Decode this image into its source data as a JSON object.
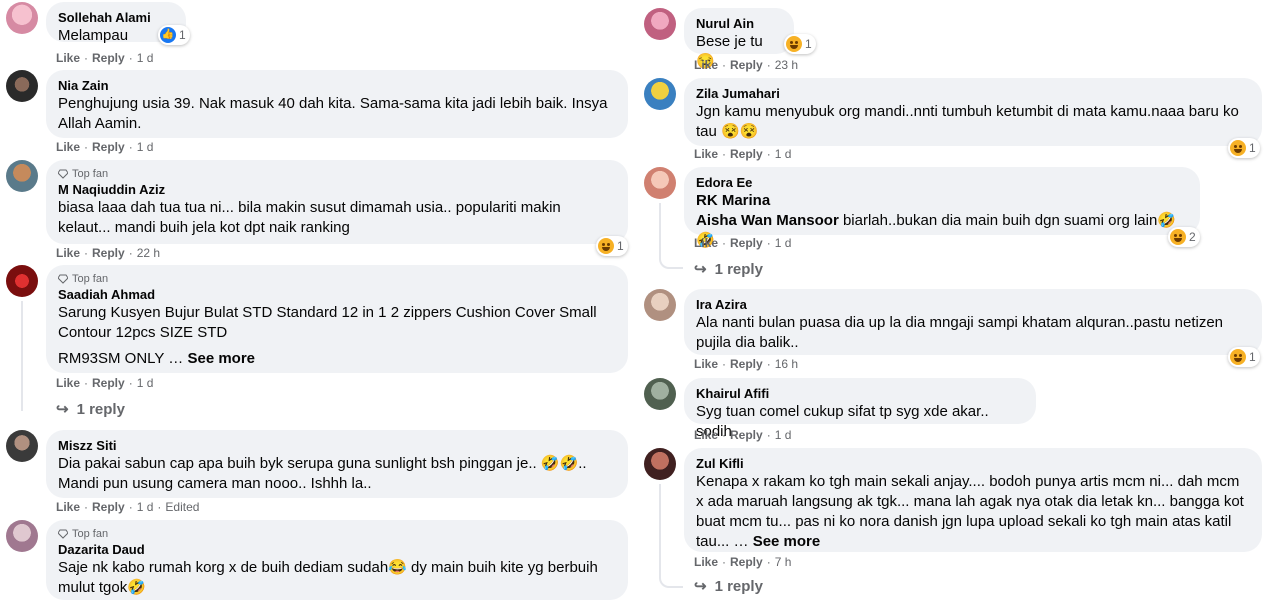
{
  "labels": {
    "like": "Like",
    "reply": "Reply",
    "top_fan": "Top fan",
    "see_more": "See more",
    "edited": "Edited"
  },
  "left_comments": [
    {
      "author": "Sollehah Alami",
      "text": "Melampau",
      "time": "1 d",
      "reaction": {
        "icon": "like-reaction-icon",
        "count": "1"
      }
    },
    {
      "author": "Nia Zain",
      "text": "Penghujung usia 39. Nak masuk 40 dah kita. Sama-sama kita jadi lebih baik. Insya Allah Aamin.",
      "time": "1 d"
    },
    {
      "author": "M Naqiuddin Aziz",
      "top_fan": true,
      "text": "biasa laaa dah tua tua ni... bila makin susut dimamah usia.. populariti makin kelaut... mandi buih jela kot dpt naik ranking",
      "time": "22 h",
      "reaction": {
        "icon": "haha-reaction-icon",
        "count": "1"
      }
    },
    {
      "author": "Saadiah Ahmad",
      "top_fan": true,
      "text": "Sarung Kusyen Bujur Bulat STD Standard 12 in 1 2 zippers Cushion Cover Small Contour 12pcs SIZE STD",
      "text2": "RM93SM ONLY …",
      "time": "1 d",
      "replies": "1 reply"
    },
    {
      "author": "Miszz Siti",
      "text": "Dia pakai sabun cap apa buih byk serupa guna sunlight bsh pinggan je.. 🤣🤣.. Mandi pun usung camera man nooo.. Ishhh la..",
      "time": "1 d",
      "edited": true
    },
    {
      "author": "Dazarita Daud",
      "top_fan": true,
      "text": "Saje nk kabo rumah korg x de buih dediam sudah😂 dy main buih kite yg berbuih mulut tgok🤣"
    }
  ],
  "right_comments": [
    {
      "author": "Nurul Ain",
      "text": "Bese je tu 😒",
      "time": "23 h",
      "reaction": {
        "icon": "haha-reaction-icon",
        "count": "1"
      }
    },
    {
      "author": "Zila Jumahari",
      "text": "Jgn kamu menyubuk org mandi..nnti tumbuh ketumbit di mata kamu.naaa baru ko tau 😵😵",
      "time": "1 d",
      "reaction": {
        "icon": "haha-reaction-icon",
        "count": "1"
      }
    },
    {
      "author": "Edora Ee",
      "text_line1": "RK Marina",
      "mention": "Aisha Wan Mansoor",
      "text": " biarlah..bukan dia main buih dgn suami org lain🤣🤣",
      "time": "1 d",
      "reaction": {
        "icon": "haha-reaction-icon",
        "count": "2"
      },
      "replies": "1 reply"
    },
    {
      "author": "Ira Azira",
      "text": "Ala nanti bulan puasa dia up la dia mngaji sampi khatam alquran..pastu netizen pujila dia balik..",
      "time": "16 h",
      "reaction": {
        "icon": "haha-reaction-icon",
        "count": "1"
      }
    },
    {
      "author": "Khairul Afifi",
      "text": "Syg tuan comel cukup sifat tp syg xde akar.. sodih",
      "time": "1 d"
    },
    {
      "author": "Zul Kifli",
      "text": "Kenapa x rakam ko tgh main sekali anjay.... bodoh punya artis mcm ni... dah mcm x ada maruah langsung ak tgk... mana lah agak nya otak dia letak kn... bangga kot buat mcm tu... pas ni ko nora danish jgn lupa upload sekali ko tgh main atas katil tau... …",
      "time": "7 h",
      "replies": "1 reply"
    }
  ],
  "colors": {
    "bubble": "#f0f2f5",
    "meta": "#65676b",
    "like_blue": "#1877f2",
    "haha_yellow": "#f7b125"
  }
}
